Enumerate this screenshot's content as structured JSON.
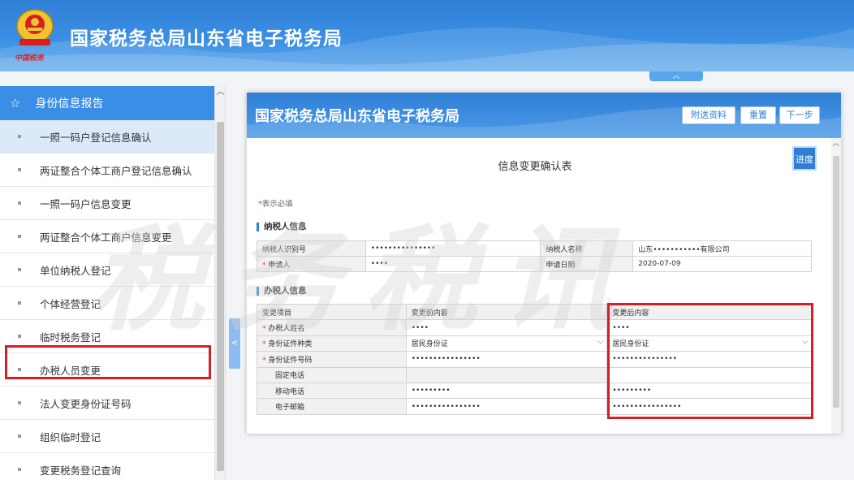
{
  "header": {
    "title": "国家税务总局山东省电子税务局",
    "emblem_text": "中国税务",
    "icon": "tax-emblem-icon"
  },
  "collapse_tab": {
    "icon": "chevron-up-icon",
    "glyph": "︿"
  },
  "sidebar": {
    "section_title": "身份信息报告",
    "section_icon": "star-icon",
    "items": [
      {
        "label": "一照一码户登记信息确认",
        "active": true
      },
      {
        "label": "两证整合个体工商户登记信息确认"
      },
      {
        "label": "一照一码户信息变更"
      },
      {
        "label": "两证整合个体工商户信息变更"
      },
      {
        "label": "单位纳税人登记"
      },
      {
        "label": "个体经营登记"
      },
      {
        "label": "临时税务登记"
      },
      {
        "label": "办税人员变更",
        "highlighted": true
      },
      {
        "label": "法人变更身份证号码"
      },
      {
        "label": "组织临时登记"
      },
      {
        "label": "变更税务登记查询"
      }
    ],
    "toggle_glyph": "<"
  },
  "panel": {
    "title": "国家税务总局山东省电子税务局",
    "buttons": {
      "attach": "附送资料",
      "reset": "重置",
      "next": "下一步"
    },
    "progress_label": "进度",
    "form_title": "信息变更确认表",
    "required_note": "表示必填",
    "required_mark": "*",
    "taxpayer_section": "纳税人信息",
    "taxpayer": {
      "id_label": "纳税人识别号",
      "id_value": "•••••••••••••••",
      "name_label": "纳税人名称",
      "name_value": "山东•••••••••••有限公司",
      "applicant_label": "申请人",
      "applicant_value": "••••",
      "date_label": "申请日期",
      "date_value": "2020-07-09"
    },
    "agent_section": "办税人信息",
    "agent_table": {
      "headers": [
        "变更项目",
        "变更前内容",
        "变更后内容"
      ],
      "rows": [
        {
          "item": "办税人姓名",
          "required": true,
          "before": "••••",
          "after": "••••"
        },
        {
          "item": "身份证件种类",
          "required": true,
          "before": "居民身份证",
          "after": "居民身份证",
          "select": true
        },
        {
          "item": "身份证件号码",
          "required": true,
          "before": "••••••••••••••••",
          "after": "•••••••••••••••"
        },
        {
          "item": "固定电话",
          "required": false,
          "before": "",
          "after": ""
        },
        {
          "item": "移动电话",
          "required": false,
          "before": "•••••••••",
          "after": "•••••••••"
        },
        {
          "item": "电子邮箱",
          "required": false,
          "before": "••••••••••••••••",
          "after": "••••••••••••••••"
        }
      ]
    }
  },
  "watermark": "税务税讯"
}
